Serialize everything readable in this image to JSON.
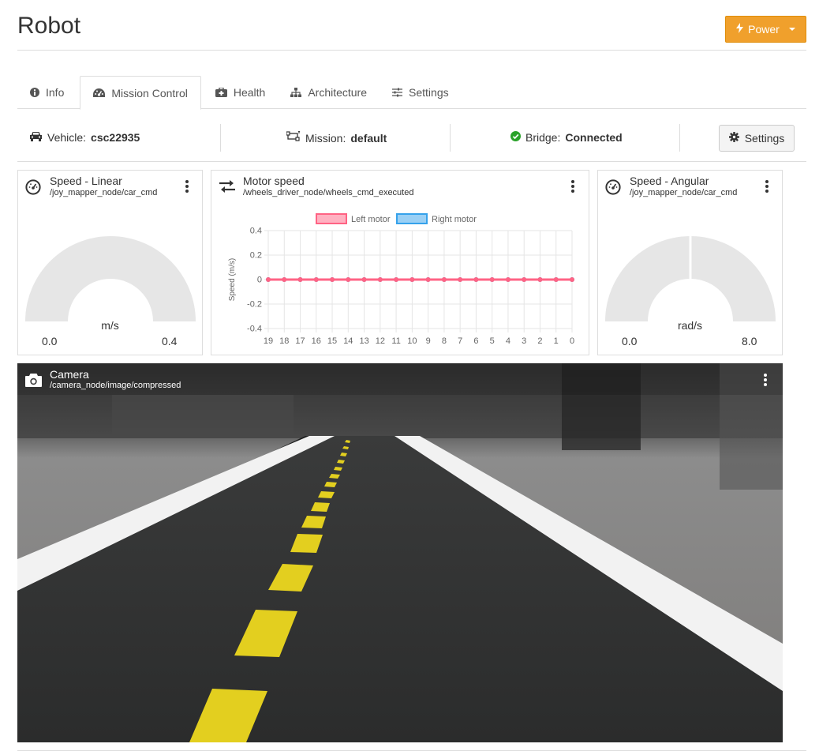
{
  "page": {
    "title": "Robot"
  },
  "power_button": {
    "label": "Power"
  },
  "tabs": [
    {
      "label": "Info",
      "icon": "info-icon"
    },
    {
      "label": "Mission Control",
      "icon": "dashboard-icon",
      "active": true
    },
    {
      "label": "Health",
      "icon": "medkit-icon"
    },
    {
      "label": "Architecture",
      "icon": "sitemap-icon"
    },
    {
      "label": "Settings",
      "icon": "sliders-icon"
    }
  ],
  "status": {
    "vehicle_label": "Vehicle:",
    "vehicle_value": "csc22935",
    "mission_label": "Mission:",
    "mission_value": "default",
    "bridge_label": "Bridge:",
    "bridge_value": "Connected",
    "settings_label": "Settings"
  },
  "speed_linear": {
    "title": "Speed - Linear",
    "topic": "/joy_mapper_node/car_cmd",
    "unit": "m/s",
    "min": "0.0",
    "max": "0.4",
    "value_fraction": 0.0
  },
  "motor_speed": {
    "title": "Motor speed",
    "topic": "/wheels_driver_node/wheels_cmd_executed"
  },
  "speed_angular": {
    "title": "Speed - Angular",
    "topic": "/joy_mapper_node/car_cmd",
    "unit": "rad/s",
    "min": "0.0",
    "max": "8.0",
    "value_fraction": 0.5
  },
  "camera": {
    "title": "Camera",
    "topic": "/camera_node/image/compressed"
  },
  "colors": {
    "accent": "#f0a02c",
    "left_motor": "#ff6384",
    "right_motor": "#36a2eb",
    "connected": "#2aa22a",
    "gauge": "#e6e6e6"
  },
  "chart_data": {
    "type": "line",
    "x": [
      "19",
      "18",
      "17",
      "16",
      "15",
      "14",
      "13",
      "12",
      "11",
      "10",
      "9",
      "8",
      "7",
      "6",
      "5",
      "4",
      "3",
      "2",
      "1",
      "0"
    ],
    "series": [
      {
        "name": "Left motor",
        "values": [
          0,
          0,
          0,
          0,
          0,
          0,
          0,
          0,
          0,
          0,
          0,
          0,
          0,
          0,
          0,
          0,
          0,
          0,
          0,
          0
        ]
      },
      {
        "name": "Right motor",
        "values": [
          0,
          0,
          0,
          0,
          0,
          0,
          0,
          0,
          0,
          0,
          0,
          0,
          0,
          0,
          0,
          0,
          0,
          0,
          0,
          0
        ]
      }
    ],
    "yticks": [
      "0.4",
      "0.2",
      "0",
      "-0.2",
      "-0.4"
    ],
    "ylabel": "Speed (m/s)",
    "ylim": [
      -0.4,
      0.4
    ],
    "grid": true,
    "legend": "top-center"
  }
}
